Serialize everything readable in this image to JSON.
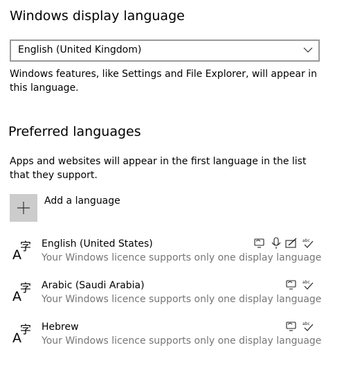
{
  "display_language": {
    "title": "Windows display language",
    "selected": "English (United Kingdom)",
    "description": "Windows features, like Settings and File Explorer, will appear in this language."
  },
  "preferred": {
    "title": "Preferred languages",
    "description": "Apps and websites will appear in the first language in the list that they support.",
    "add_label": "Add a language",
    "languages": [
      {
        "name": "English (United States)",
        "note": "Your Windows licence supports only one display language",
        "features": [
          "text-to-speech-icon",
          "speech-icon",
          "handwriting-icon",
          "spellcheck-icon"
        ]
      },
      {
        "name": "Arabic (Saudi Arabia)",
        "note": "Your Windows licence supports only one display language",
        "features": [
          "text-to-speech-icon",
          "spellcheck-icon"
        ]
      },
      {
        "name": "Hebrew",
        "note": "Your Windows licence supports only one display language",
        "features": [
          "text-to-speech-icon",
          "spellcheck-icon"
        ]
      }
    ]
  },
  "colors": {
    "accent_tile": "#cccccc",
    "secondary_text": "#767676",
    "border": "#999999"
  }
}
